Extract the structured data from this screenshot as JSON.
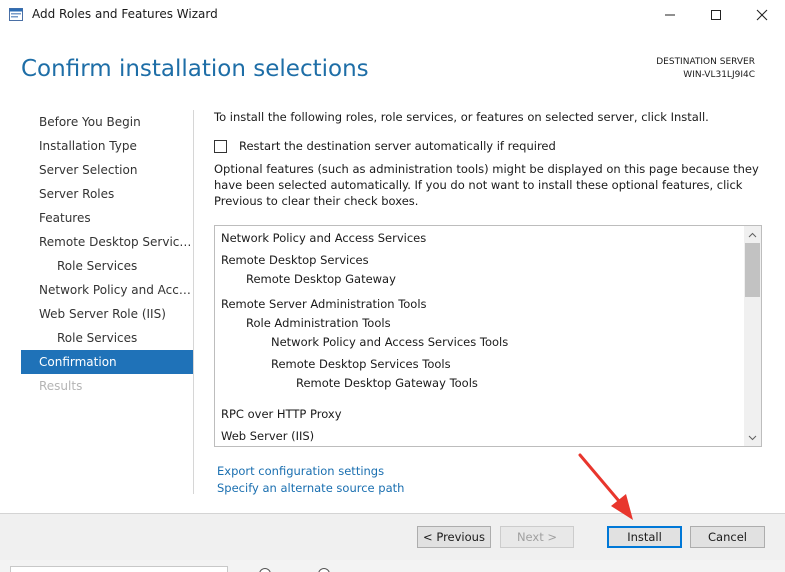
{
  "window": {
    "title": "Add Roles and Features Wizard",
    "controls": [
      "minimize-icon",
      "maximize-icon",
      "close-icon"
    ]
  },
  "header": {
    "page_title": "Confirm installation selections",
    "destination_label": "DESTINATION SERVER",
    "destination_server": "WIN-VL31LJ9I4C"
  },
  "nav": {
    "items": [
      {
        "label": "Before You Begin",
        "level": 0,
        "state": "normal"
      },
      {
        "label": "Installation Type",
        "level": 0,
        "state": "normal"
      },
      {
        "label": "Server Selection",
        "level": 0,
        "state": "normal"
      },
      {
        "label": "Server Roles",
        "level": 0,
        "state": "normal"
      },
      {
        "label": "Features",
        "level": 0,
        "state": "normal"
      },
      {
        "label": "Remote Desktop Services",
        "level": 0,
        "state": "normal"
      },
      {
        "label": "Role Services",
        "level": 1,
        "state": "normal"
      },
      {
        "label": "Network Policy and Access Services",
        "level": 0,
        "state": "normal"
      },
      {
        "label": "Web Server Role (IIS)",
        "level": 0,
        "state": "normal"
      },
      {
        "label": "Role Services",
        "level": 1,
        "state": "normal"
      },
      {
        "label": "Confirmation",
        "level": 0,
        "state": "active"
      },
      {
        "label": "Results",
        "level": 0,
        "state": "disabled"
      }
    ]
  },
  "content": {
    "intro": "To install the following roles, role services, or features on selected server, click Install.",
    "restart_label": "Restart the destination server automatically if required",
    "restart_checked": false,
    "optional_text": "Optional features (such as administration tools) might be displayed on this page because they have been selected automatically. If you do not want to install these optional features, click Previous to clear their check boxes.",
    "features": [
      {
        "label": "Network Policy and Access Services",
        "level": 0
      },
      {
        "label": "Remote Desktop Services",
        "level": 0
      },
      {
        "label": "Remote Desktop Gateway",
        "level": 1
      },
      {
        "label": "Remote Server Administration Tools",
        "level": 0
      },
      {
        "label": "Role Administration Tools",
        "level": 1
      },
      {
        "label": "Network Policy and Access Services Tools",
        "level": 2
      },
      {
        "label": "Remote Desktop Services Tools",
        "level": 2
      },
      {
        "label": "Remote Desktop Gateway Tools",
        "level": 3
      },
      {
        "label": "RPC over HTTP Proxy",
        "level": 0
      },
      {
        "label": "Web Server (IIS)",
        "level": 0
      }
    ],
    "links": {
      "export": "Export configuration settings",
      "alternate_source": "Specify an alternate source path"
    }
  },
  "footer": {
    "previous": "< Previous",
    "next": "Next >",
    "install": "Install",
    "cancel": "Cancel"
  },
  "colors": {
    "accent": "#1f72b8",
    "title_blue": "#1e6ea7",
    "link": "#1a6fb0",
    "annotation_arrow": "#e8362d"
  }
}
